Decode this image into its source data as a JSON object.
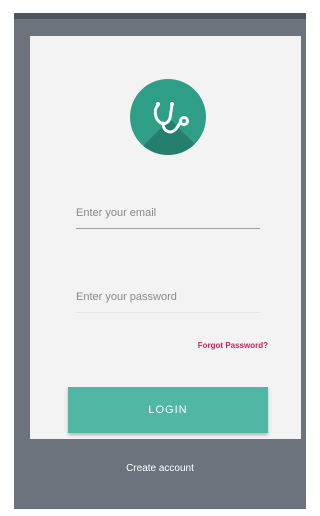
{
  "logo": {
    "icon": "stethoscope-icon",
    "color": "#2e9e86"
  },
  "form": {
    "email_placeholder": "Enter your email",
    "password_placeholder": "Enter your password",
    "forgot_label": "Forgot Password?",
    "login_label": "LOGIN"
  },
  "footer": {
    "create_account_label": "Create account"
  },
  "colors": {
    "accent": "#4fb7a4",
    "link": "#d81b60",
    "background": "#6c737c"
  }
}
